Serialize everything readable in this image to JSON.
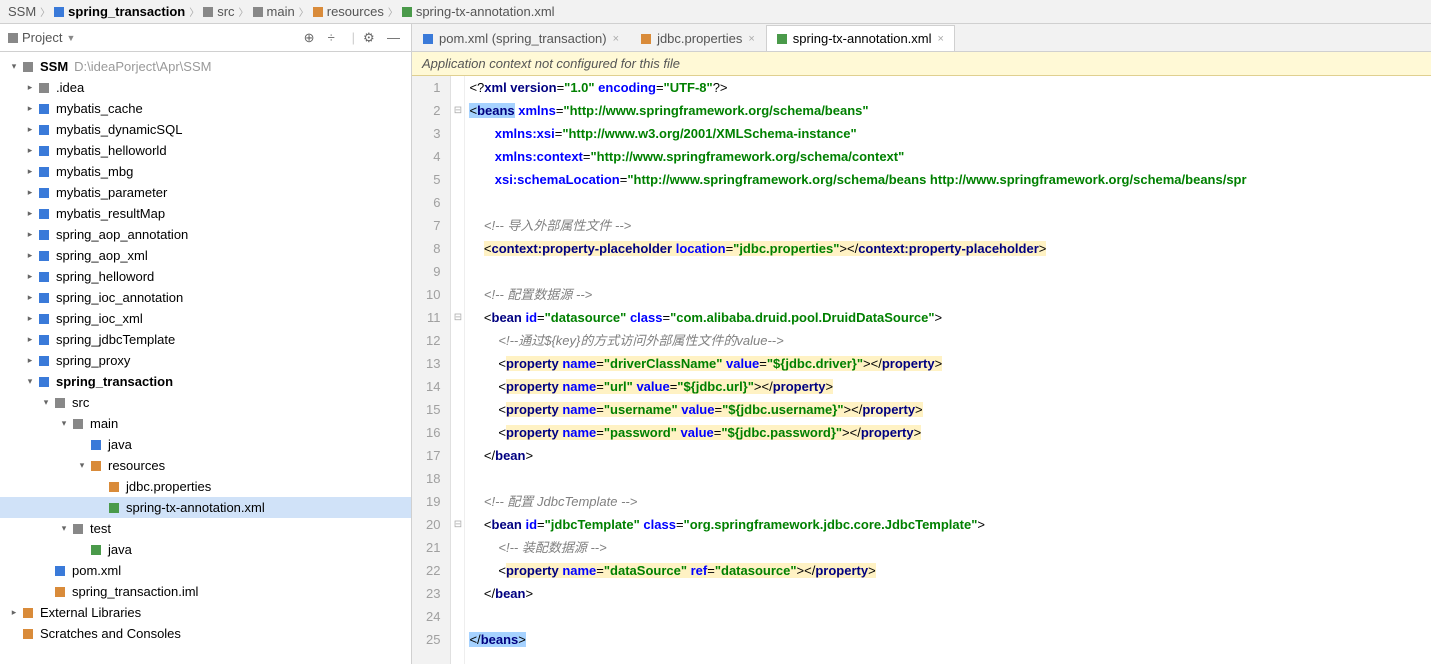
{
  "breadcrumb": [
    "SSM",
    "spring_transaction",
    "src",
    "main",
    "resources",
    "spring-tx-annotation.xml"
  ],
  "project_label": "Project",
  "root_name": "SSM",
  "root_path": "D:\\ideaPorject\\Apr\\SSM",
  "tree": [
    {
      "name": ".idea",
      "ind": 1,
      "arr": ">",
      "type": "dir"
    },
    {
      "name": "mybatis_cache",
      "ind": 1,
      "arr": ">",
      "type": "mod"
    },
    {
      "name": "mybatis_dynamicSQL",
      "ind": 1,
      "arr": ">",
      "type": "mod"
    },
    {
      "name": "mybatis_helloworld",
      "ind": 1,
      "arr": ">",
      "type": "mod"
    },
    {
      "name": "mybatis_mbg",
      "ind": 1,
      "arr": ">",
      "type": "mod"
    },
    {
      "name": "mybatis_parameter",
      "ind": 1,
      "arr": ">",
      "type": "mod"
    },
    {
      "name": "mybatis_resultMap",
      "ind": 1,
      "arr": ">",
      "type": "mod"
    },
    {
      "name": "spring_aop_annotation",
      "ind": 1,
      "arr": ">",
      "type": "mod"
    },
    {
      "name": "spring_aop_xml",
      "ind": 1,
      "arr": ">",
      "type": "mod"
    },
    {
      "name": "spring_helloword",
      "ind": 1,
      "arr": ">",
      "type": "mod"
    },
    {
      "name": "spring_ioc_annotation",
      "ind": 1,
      "arr": ">",
      "type": "mod"
    },
    {
      "name": "spring_ioc_xml",
      "ind": 1,
      "arr": ">",
      "type": "mod"
    },
    {
      "name": "spring_jdbcTemplate",
      "ind": 1,
      "arr": ">",
      "type": "mod"
    },
    {
      "name": "spring_proxy",
      "ind": 1,
      "arr": ">",
      "type": "mod"
    },
    {
      "name": "spring_transaction",
      "ind": 1,
      "arr": "v",
      "type": "mod",
      "bold": true
    },
    {
      "name": "src",
      "ind": 2,
      "arr": "v",
      "type": "dir"
    },
    {
      "name": "main",
      "ind": 3,
      "arr": "v",
      "type": "dir"
    },
    {
      "name": "java",
      "ind": 4,
      "arr": "",
      "type": "src"
    },
    {
      "name": "resources",
      "ind": 4,
      "arr": "v",
      "type": "res"
    },
    {
      "name": "jdbc.properties",
      "ind": 5,
      "arr": "",
      "type": "prop"
    },
    {
      "name": "spring-tx-annotation.xml",
      "ind": 5,
      "arr": "",
      "type": "xml",
      "sel": true
    },
    {
      "name": "test",
      "ind": 3,
      "arr": "v",
      "type": "dir"
    },
    {
      "name": "java",
      "ind": 4,
      "arr": "",
      "type": "testsrc"
    },
    {
      "name": "pom.xml",
      "ind": 2,
      "arr": "",
      "type": "maven"
    },
    {
      "name": "spring_transaction.iml",
      "ind": 2,
      "arr": "",
      "type": "iml"
    }
  ],
  "ext_libs": "External Libraries",
  "scratches": "Scratches and Consoles",
  "tabs": [
    {
      "label": "pom.xml (spring_transaction)",
      "type": "maven",
      "active": false
    },
    {
      "label": "jdbc.properties",
      "type": "prop",
      "active": false
    },
    {
      "label": "spring-tx-annotation.xml",
      "type": "xml",
      "active": true
    }
  ],
  "warn": "Application context not configured for this file",
  "code": {
    "l1": {
      "a": "<?",
      "b": "xml version",
      "c": "=",
      "d": "\"1.0\"",
      "e": " encoding",
      "f": "=",
      "g": "\"UTF-8\"",
      "h": "?>"
    },
    "l2": {
      "a": "<",
      "b": "beans",
      "c": " xmlns",
      "d": "=",
      "e": "\"http://www.springframework.org/schema/beans\""
    },
    "l3": {
      "a": "       xmlns:xsi",
      "b": "=",
      "c": "\"http://www.w3.org/2001/XMLSchema-instance\""
    },
    "l4": {
      "a": "       xmlns:context",
      "b": "=",
      "c": "\"http://www.springframework.org/schema/context\""
    },
    "l5": {
      "a": "       xsi:schemaLocation",
      "b": "=",
      "c": "\"http://www.springframework.org/schema/beans http://www.springframework.org/schema/beans/spr"
    },
    "l7": "    <!-- 导入外部属性文件 -->",
    "l8": {
      "a": "    <",
      "b": "context:property-placeholder",
      "c": " location",
      "d": "=",
      "e": "\"jdbc.properties\"",
      "f": "></",
      "g": "context:property-placeholder",
      "h": ">"
    },
    "l10": "    <!-- 配置数据源 -->",
    "l11": {
      "a": "    <",
      "b": "bean",
      "c": " id",
      "d": "=",
      "e": "\"datasource\"",
      "f": " class",
      "g": "=",
      "h": "\"com.alibaba.druid.pool.DruidDataSource\"",
      "i": ">"
    },
    "l12": "        <!--通过${key}的方式访问外部属性文件的value-->",
    "l13": {
      "a": "        <",
      "b": "property",
      "c": " name",
      "d": "=",
      "e": "\"driverClassName\"",
      "f": " value",
      "g": "=",
      "h": "\"${jdbc.driver}\"",
      "i": "></",
      "j": "property",
      "k": ">"
    },
    "l14": {
      "a": "        <",
      "b": "property",
      "c": " name",
      "d": "=",
      "e": "\"url\"",
      "f": " value",
      "g": "=",
      "h": "\"${jdbc.url}\"",
      "i": "></",
      "j": "property",
      "k": ">"
    },
    "l15": {
      "a": "        <",
      "b": "property",
      "c": " name",
      "d": "=",
      "e": "\"username\"",
      "f": " value",
      "g": "=",
      "h": "\"${jdbc.username}\"",
      "i": "></",
      "j": "property",
      "k": ">"
    },
    "l16": {
      "a": "        <",
      "b": "property",
      "c": " name",
      "d": "=",
      "e": "\"password\"",
      "f": " value",
      "g": "=",
      "h": "\"${jdbc.password}\"",
      "i": "></",
      "j": "property",
      "k": ">"
    },
    "l17": {
      "a": "    </",
      "b": "bean",
      "c": ">"
    },
    "l19": "    <!-- 配置 JdbcTemplate -->",
    "l20": {
      "a": "    <",
      "b": "bean",
      "c": " id",
      "d": "=",
      "e": "\"jdbcTemplate\"",
      "f": " class",
      "g": "=",
      "h": "\"org.springframework.jdbc.core.JdbcTemplate\"",
      "i": ">"
    },
    "l21": "        <!-- 装配数据源 -->",
    "l22": {
      "a": "        <",
      "b": "property",
      "c": " name",
      "d": "=",
      "e": "\"dataSource\"",
      "f": " ref",
      "g": "=",
      "h": "\"datasource\"",
      "i": "></",
      "j": "property",
      "k": ">"
    },
    "l23": {
      "a": "    </",
      "b": "bean",
      "c": ">"
    },
    "l25": {
      "a": "</",
      "b": "beans",
      "c": ">"
    }
  }
}
